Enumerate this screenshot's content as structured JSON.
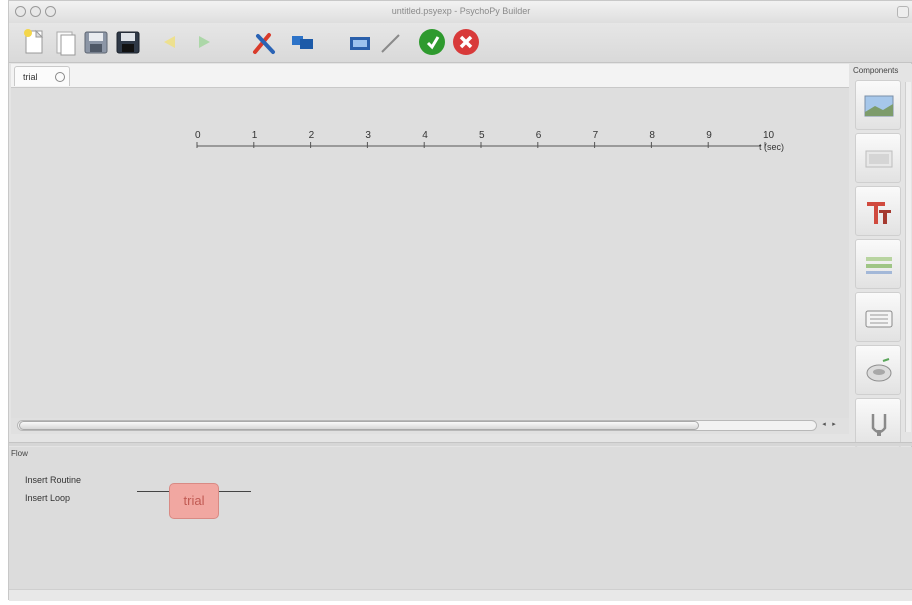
{
  "window": {
    "title": "untitled.psyexp - PsychoPy Builder"
  },
  "toolbar": {
    "buttons": [
      {
        "name": "new-file",
        "icon": "new-document-icon"
      },
      {
        "name": "open-file",
        "icon": "open-document-icon"
      },
      {
        "name": "save",
        "icon": "save-disk-icon"
      },
      {
        "name": "save-as",
        "icon": "save-as-disk-icon"
      },
      {
        "name": "undo",
        "icon": "undo-arrow-icon"
      },
      {
        "name": "redo",
        "icon": "redo-arrow-icon"
      },
      {
        "name": "preferences",
        "icon": "tools-icon"
      },
      {
        "name": "monitor-center",
        "icon": "monitors-icon"
      },
      {
        "name": "experiment-settings",
        "icon": "settings-monitor-icon"
      },
      {
        "name": "compile-script",
        "icon": "compile-script-icon"
      },
      {
        "name": "run",
        "icon": "run-green-icon"
      },
      {
        "name": "stop",
        "icon": "stop-red-icon"
      }
    ]
  },
  "routine": {
    "tabs": [
      {
        "label": "trial"
      }
    ],
    "timeline": {
      "ticks": [
        "0",
        "1",
        "2",
        "3",
        "4",
        "5",
        "6",
        "7",
        "8",
        "9",
        "10"
      ],
      "unit_label": "t (sec)"
    }
  },
  "components": {
    "title": "Components",
    "items": [
      {
        "name": "image",
        "icon": "image-component-icon"
      },
      {
        "name": "movie",
        "icon": "movie-component-icon"
      },
      {
        "name": "text",
        "icon": "text-component-icon"
      },
      {
        "name": "patch",
        "icon": "patch-component-icon"
      },
      {
        "name": "keyboard",
        "icon": "keyboard-component-icon"
      },
      {
        "name": "mouse",
        "icon": "dots-component-icon"
      },
      {
        "name": "sound",
        "icon": "sound-component-icon"
      }
    ]
  },
  "flow": {
    "title": "Flow",
    "insert_routine": "Insert Routine",
    "insert_loop": "Insert Loop",
    "routines": [
      {
        "label": "trial"
      }
    ]
  },
  "colors": {
    "run_green": "#2e9a2e",
    "stop_red": "#d83a3a",
    "routine_fill": "#f1a7a1",
    "routine_text": "#c15a53"
  }
}
